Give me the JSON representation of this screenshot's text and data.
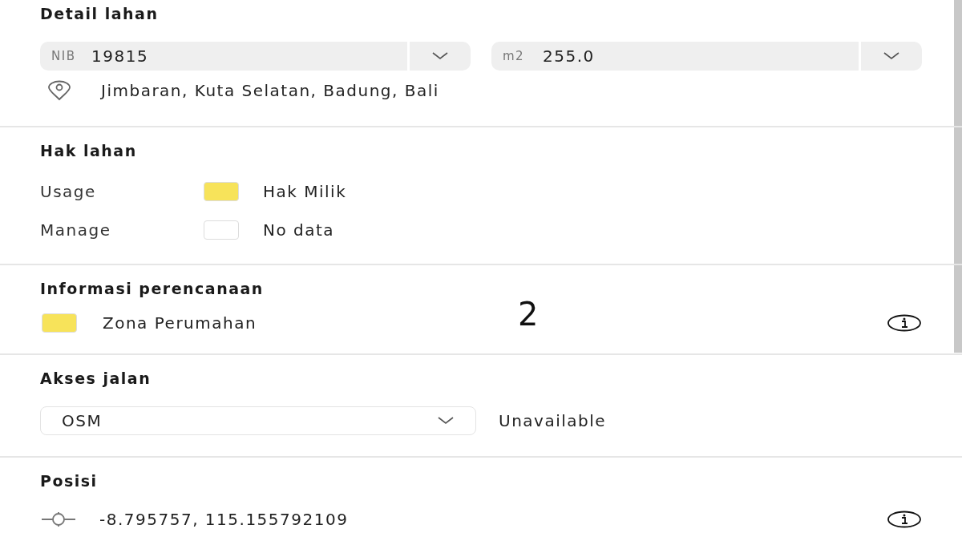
{
  "sections": [
    {
      "kind": "detail",
      "title": "Detail lahan",
      "fields": [
        {
          "prefix": "NIB",
          "value": "19815"
        },
        {
          "prefix": "m2",
          "value": "255.0"
        }
      ],
      "address": "Jimbaran, Kuta Selatan, Badung, Bali"
    },
    {
      "kind": "rights",
      "title": "Hak lahan",
      "rows": [
        {
          "label": "Usage",
          "value": "Hak Milik",
          "color": "#f7e35a"
        },
        {
          "label": "Manage",
          "value": "No data",
          "color": "#ffffff"
        }
      ]
    },
    {
      "kind": "zoning",
      "title": "Informasi perencanaan",
      "zone": "Zona Perumahan",
      "color": "#f7e35a",
      "marker": "2"
    },
    {
      "kind": "road",
      "title": "Akses jalan",
      "source": "OSM",
      "status": "Unavailable"
    },
    {
      "kind": "position",
      "title": "Posisi",
      "coords": "-8.795757, 115.155792109"
    }
  ]
}
